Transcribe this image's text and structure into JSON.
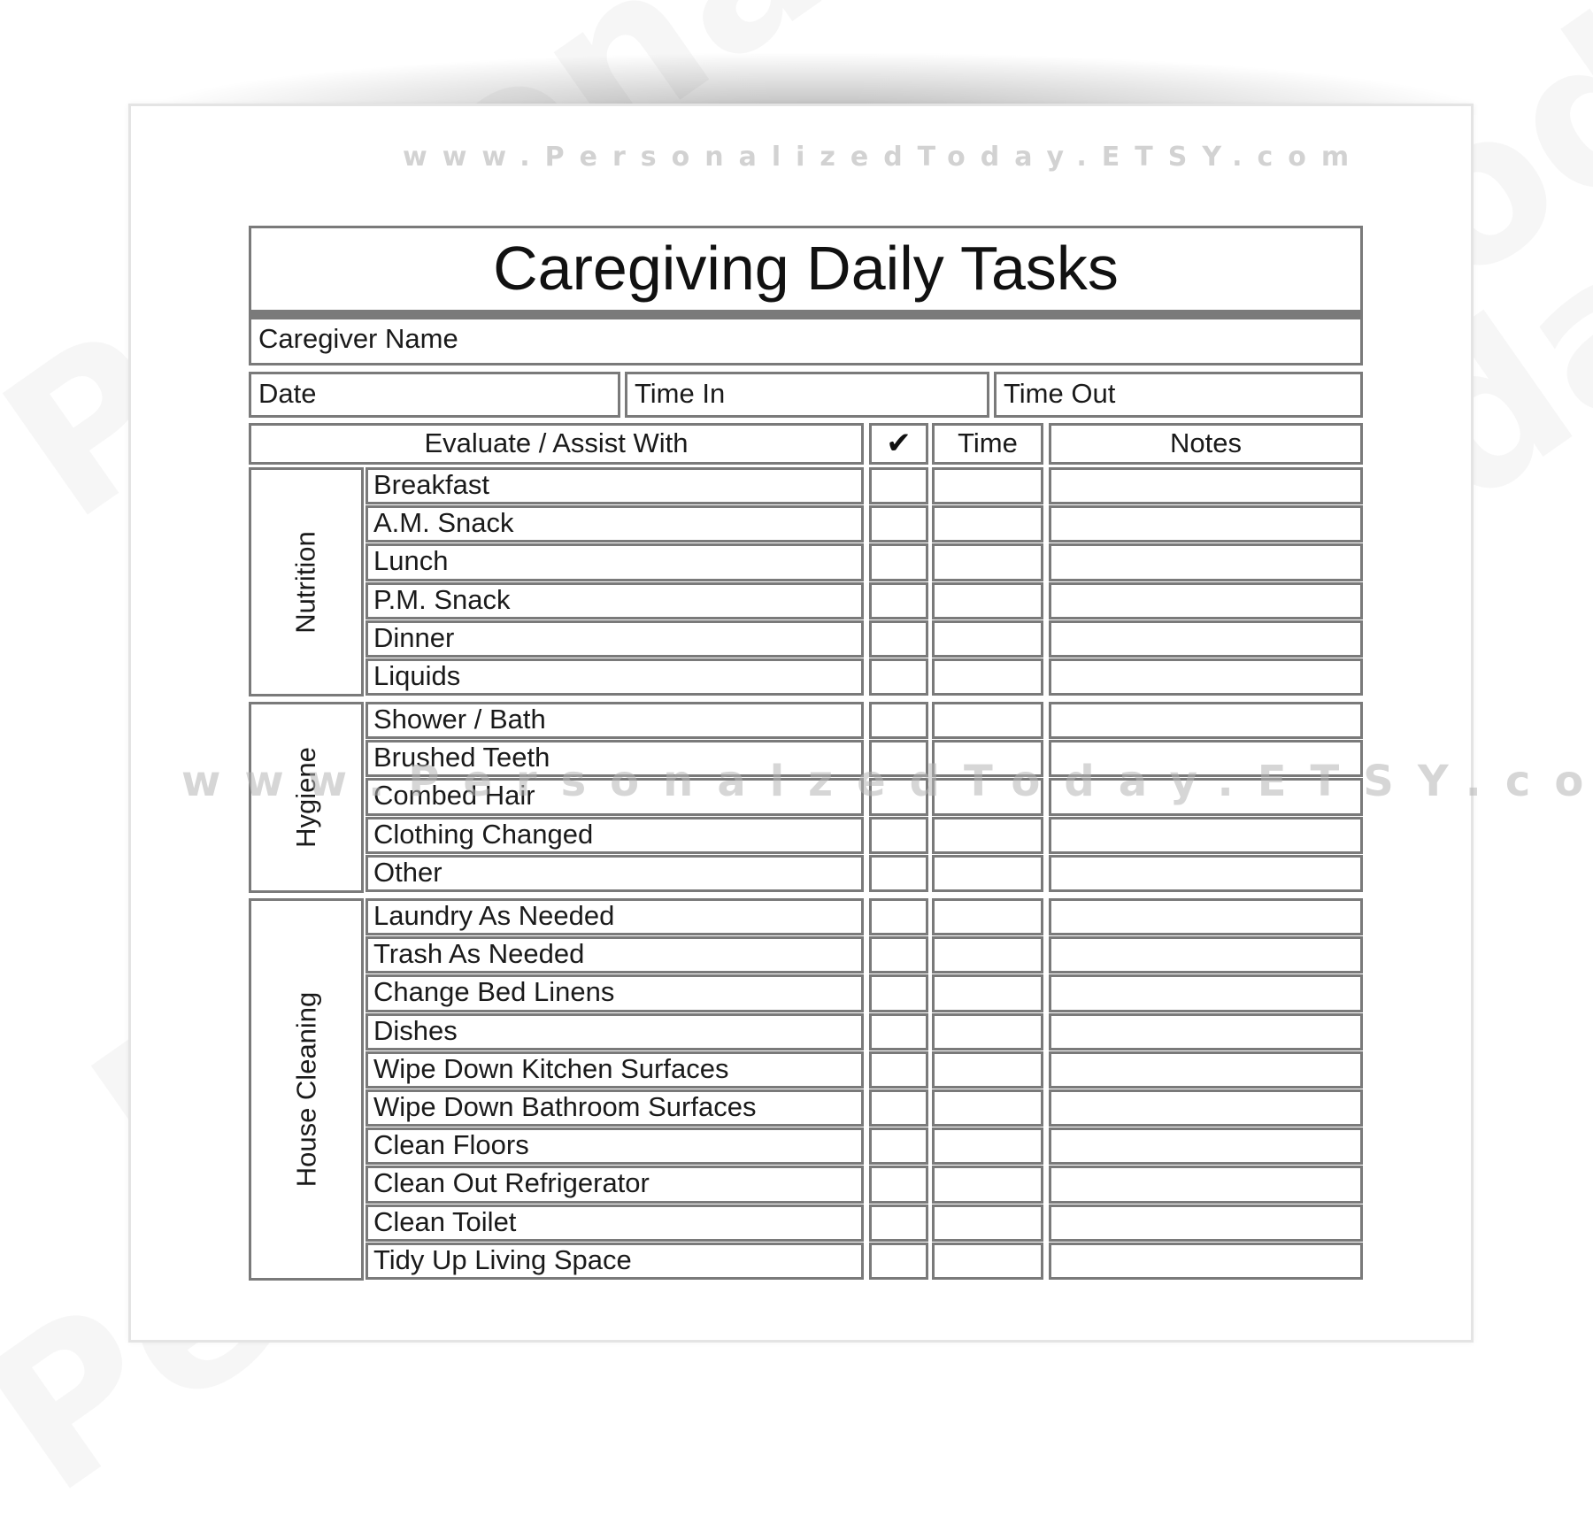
{
  "watermarks": {
    "top": "www.PersonalizedToday.ETSY.com",
    "middle": "www.PersonalzedToday.ETSY.com",
    "background": "PersonalizedToday"
  },
  "form": {
    "title": "Caregiving Daily Tasks",
    "fields": {
      "caregiver_name": {
        "label": "Caregiver Name",
        "value": ""
      },
      "date": {
        "label": "Date",
        "value": ""
      },
      "time_in": {
        "label": "Time In",
        "value": ""
      },
      "time_out": {
        "label": "Time Out",
        "value": ""
      }
    },
    "columns": {
      "task": "Evaluate / Assist With",
      "check": "✔",
      "time": "Time",
      "notes": "Notes"
    },
    "sections": [
      {
        "name": "Nutrition",
        "tasks": [
          "Breakfast",
          "A.M. Snack",
          "Lunch",
          "P.M. Snack",
          "Dinner",
          "Liquids"
        ]
      },
      {
        "name": "Hygiene",
        "tasks": [
          "Shower / Bath",
          "Brushed Teeth",
          "Combed Hair",
          "Clothing Changed",
          "Other"
        ]
      },
      {
        "name": "House Cleaning",
        "tasks": [
          "Laundry As Needed",
          "Trash As Needed",
          "Change Bed Linens",
          "Dishes",
          "Wipe Down Kitchen Surfaces",
          "Wipe Down Bathroom Surfaces",
          "Clean Floors",
          "Clean Out Refrigerator",
          "Clean Toilet",
          "Tidy Up Living Space"
        ]
      }
    ]
  },
  "colors": {
    "border": "#7a7a7a",
    "text": "#1a1a1a",
    "watermark": "#d2d2d2"
  }
}
